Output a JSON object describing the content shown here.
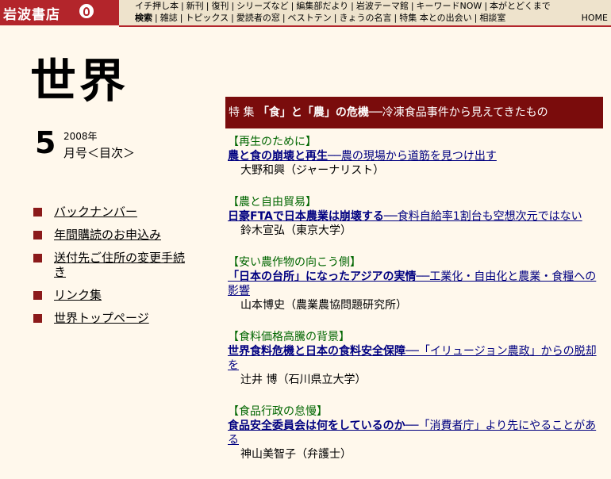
{
  "header": {
    "logo": "岩波書店",
    "nav_row1": [
      "イチ押し本",
      "新刊",
      "復刊",
      "シリーズなど",
      "編集部だより",
      "岩波テーマ館",
      "キーワードNOW",
      "本がとどくまで"
    ],
    "nav_row2": [
      "検索",
      "雑誌",
      "トピックス",
      "愛読者の窓",
      "ベストテン",
      "きょうの名言",
      "特集 本との出会い",
      "相談室"
    ],
    "home": "HOME"
  },
  "magazine": {
    "title": "世界",
    "issue_number": "5",
    "issue_year": "2008年",
    "issue_month": "月号＜目次＞"
  },
  "leftnav": [
    "バックナンバー",
    "年間購読のお申込み",
    "送付先ご住所の変更手続き",
    "リンク集",
    "世界トップページ"
  ],
  "feature": {
    "label": "特 集",
    "title": "「食」と「農」の危機",
    "subtitle": "──冷凍食品事件から見えてきたもの"
  },
  "articles": [
    {
      "category": "【再生のために】",
      "title_bold": "農と食の崩壊と再生",
      "title_rest": "──農の現場から道筋を見つけ出す",
      "author": "大野和興（ジャーナリスト）"
    },
    {
      "category": "【農と自由貿易】",
      "title_bold": "日豪FTAで日本農業は崩壊する",
      "title_rest": "──食料自給率1割台も空想次元ではない",
      "author": "鈴木宣弘（東京大学）"
    },
    {
      "category": "【安い農作物の向こう側】",
      "title_bold": "「日本の台所」になったアジアの実情",
      "title_rest": "──工業化・自由化と農業・食糧への影響",
      "author": "山本博史（農業農協問題研究所）"
    },
    {
      "category": "【食料価格高騰の背景】",
      "title_bold": "世界食料危機と日本の食料安全保障",
      "title_rest": "──「イリュージョン農政」からの脱却を",
      "author": "辻井 博（石川県立大学）"
    },
    {
      "category": "【食品行政の怠慢】",
      "title_bold": "食品安全委員会は何をしているのか",
      "title_rest": "──「消費者庁」より先にやることがある",
      "author": "神山美智子（弁護士）"
    }
  ]
}
